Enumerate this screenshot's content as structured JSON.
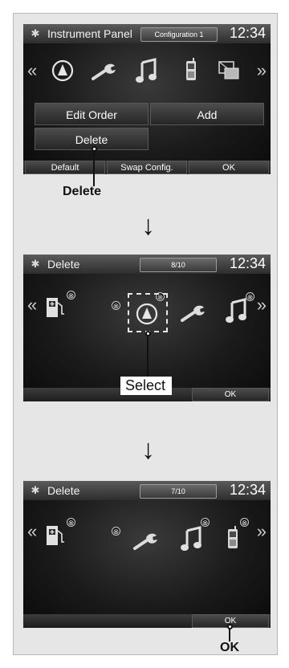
{
  "screen1": {
    "title": "Instrument Panel",
    "config_tab": "Configuration 1",
    "clock": "12:34",
    "arrow_left": "«",
    "arrow_right": "»",
    "buttons": {
      "edit_order": "Edit Order",
      "add": "Add",
      "delete": "Delete",
      "default": "Default",
      "swap_config": "Swap Config.",
      "ok": "OK"
    }
  },
  "callout1": {
    "label": "Delete"
  },
  "screen2": {
    "title": "Delete",
    "counter": "8/10",
    "clock": "12:34",
    "arrow_left": "«",
    "arrow_right": "»",
    "ok": "OK",
    "x_mark": "⊗"
  },
  "callout2": {
    "label": "Select"
  },
  "screen3": {
    "title": "Delete",
    "counter": "7/10",
    "clock": "12:34",
    "arrow_left": "«",
    "arrow_right": "»",
    "ok": "OK",
    "x_mark": "⊗"
  },
  "callout3": {
    "label": "OK"
  },
  "flow_arrow": "↓",
  "gear_glyph": "✱",
  "colors": {
    "screen_bg": "#050505",
    "header": "#4a4a4a",
    "button": "#333333"
  }
}
